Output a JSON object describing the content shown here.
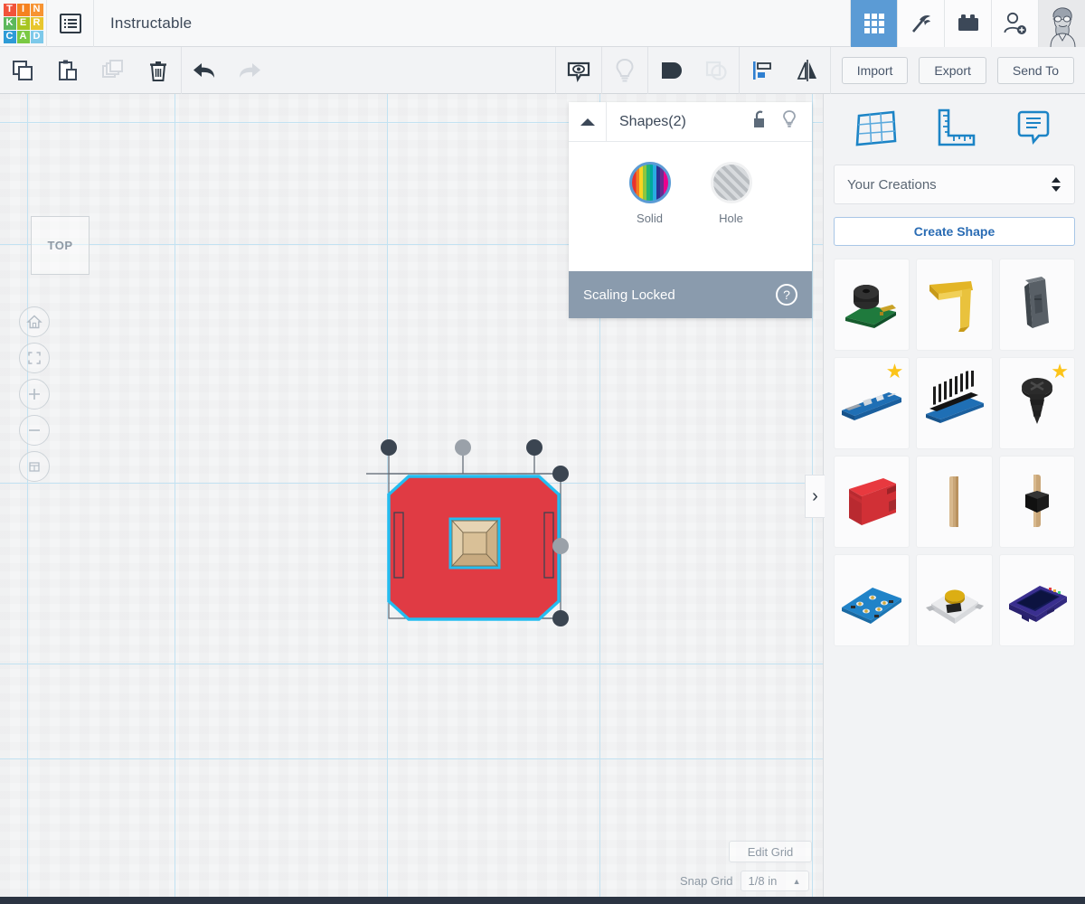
{
  "app": {
    "logo_letters": [
      {
        "char": "T",
        "color": "#f1533a"
      },
      {
        "char": "I",
        "color": "#f58220"
      },
      {
        "char": "N",
        "color": "#f79433"
      },
      {
        "char": "K",
        "color": "#5cb85c"
      },
      {
        "char": "E",
        "color": "#a7c520"
      },
      {
        "char": "R",
        "color": "#e8c62e"
      },
      {
        "char": "C",
        "color": "#2e9bd6"
      },
      {
        "char": "A",
        "color": "#7ac943"
      },
      {
        "char": "D",
        "color": "#7dc9ea"
      }
    ],
    "document_title": "Instructable",
    "menu_icon": "hamburger-list-icon"
  },
  "topbar": {
    "right_icons": [
      {
        "name": "apps-grid-icon",
        "label": "3D Designs",
        "active": true
      },
      {
        "name": "pickaxe-icon",
        "label": "Minecraft",
        "active": false
      },
      {
        "name": "lego-brick-icon",
        "label": "Blocks",
        "active": false
      },
      {
        "name": "add-user-icon",
        "label": "Invite",
        "active": false
      }
    ],
    "avatar_name": "user-avatar"
  },
  "toolbar": {
    "left_tools": [
      {
        "name": "copy-button",
        "label": "Copy",
        "enabled": true
      },
      {
        "name": "paste-button",
        "label": "Paste",
        "enabled": true
      },
      {
        "name": "duplicate-button",
        "label": "Duplicate",
        "enabled": false
      },
      {
        "name": "delete-button",
        "label": "Delete",
        "enabled": true
      }
    ],
    "history_tools": [
      {
        "name": "undo-button",
        "label": "Undo",
        "enabled": true
      },
      {
        "name": "redo-button",
        "label": "Redo",
        "enabled": false
      }
    ],
    "center_tools": [
      {
        "name": "note-button",
        "label": "Note",
        "enabled": true
      },
      {
        "name": "lightbulb-button",
        "label": "Light",
        "enabled": false
      },
      {
        "name": "group-button",
        "label": "Group",
        "enabled": true
      },
      {
        "name": "ungroup-button",
        "label": "Ungroup",
        "enabled": false
      },
      {
        "name": "align-button",
        "label": "Align",
        "enabled": true
      },
      {
        "name": "mirror-button",
        "label": "Mirror",
        "enabled": true
      }
    ],
    "import_label": "Import",
    "export_label": "Export",
    "send_to_label": "Send To"
  },
  "canvas": {
    "view_cube_label": "TOP",
    "nav_buttons": [
      {
        "name": "home-view-button",
        "icon": "home-icon"
      },
      {
        "name": "fit-view-button",
        "icon": "fit-to-screen-icon"
      },
      {
        "name": "zoom-in-button",
        "icon": "plus-icon"
      },
      {
        "name": "zoom-out-button",
        "icon": "minus-icon"
      },
      {
        "name": "perspective-toggle-button",
        "icon": "box-icon"
      }
    ],
    "gridline_color": "#c2e2f2",
    "vertical_gridlines": [
      30,
      193,
      428,
      663,
      898
    ],
    "horizontal_gridlines": [
      31,
      166,
      430,
      630,
      735
    ],
    "shape": {
      "name": "selected-3d-shape",
      "body_color": "#e03b44",
      "outline_color": "#24bdf0",
      "inner_color": "#dbc39b",
      "handles": [
        {
          "name": "corner-handle-top-left",
          "color": "#3b4551"
        },
        {
          "name": "rotate-handle-top",
          "color": "#9aa1a9"
        },
        {
          "name": "corner-handle-top-right",
          "color": "#3b4551"
        },
        {
          "name": "height-handle-right",
          "color": "#3b4551"
        },
        {
          "name": "rotate-handle-right",
          "color": "#9aa1a9"
        },
        {
          "name": "corner-handle-bottom-right",
          "color": "#3b4551"
        }
      ]
    }
  },
  "shapes_panel": {
    "title": "Shapes(2)",
    "collapse_icon": "triangle-up-icon",
    "lock_icon": "unlocked-padlock-icon",
    "light_icon": "lightbulb-icon",
    "options": [
      {
        "name": "solid-swatch",
        "label": "Solid",
        "selected": true
      },
      {
        "name": "hole-swatch",
        "label": "Hole",
        "selected": false
      }
    ],
    "status_text": "Scaling Locked",
    "help_label": "?",
    "status_bg": "#8a9bad"
  },
  "right_panel": {
    "tool_icons": [
      {
        "name": "workplane-icon",
        "label": "Workplane"
      },
      {
        "name": "ruler-icon",
        "label": "Ruler"
      },
      {
        "name": "note-icon",
        "label": "Note"
      }
    ],
    "library_select_value": "Your Creations",
    "create_shape_label": "Create Shape",
    "collapse_chevron": "›",
    "shapes": [
      {
        "name": "shape-buzzer-module",
        "label": "Buzzer Module",
        "starred": false
      },
      {
        "name": "shape-allen-key",
        "label": "Allen Key",
        "starred": false
      },
      {
        "name": "shape-gray-block",
        "label": "Gray Block",
        "starred": false
      },
      {
        "name": "shape-sensor-board",
        "label": "Sensor Board",
        "starred": true
      },
      {
        "name": "shape-header-pins-board",
        "label": "Header Pins Board",
        "starred": false
      },
      {
        "name": "shape-screw",
        "label": "Screw",
        "starred": true
      },
      {
        "name": "shape-red-block",
        "label": "Red Block",
        "starred": false
      },
      {
        "name": "shape-wooden-stick",
        "label": "Wooden Stick",
        "starred": false
      },
      {
        "name": "shape-stick-connector",
        "label": "Stick Connector",
        "starred": false
      },
      {
        "name": "shape-circuit-board",
        "label": "Circuit Board",
        "starred": false
      },
      {
        "name": "shape-tactile-switch",
        "label": "Tactile Switch",
        "starred": false
      },
      {
        "name": "shape-display-module",
        "label": "Display Module",
        "starred": false
      }
    ]
  },
  "bottom_controls": {
    "edit_grid_label": "Edit Grid",
    "snap_grid_label": "Snap Grid",
    "snap_grid_value": "1/8 in",
    "snap_caret": "▲"
  }
}
